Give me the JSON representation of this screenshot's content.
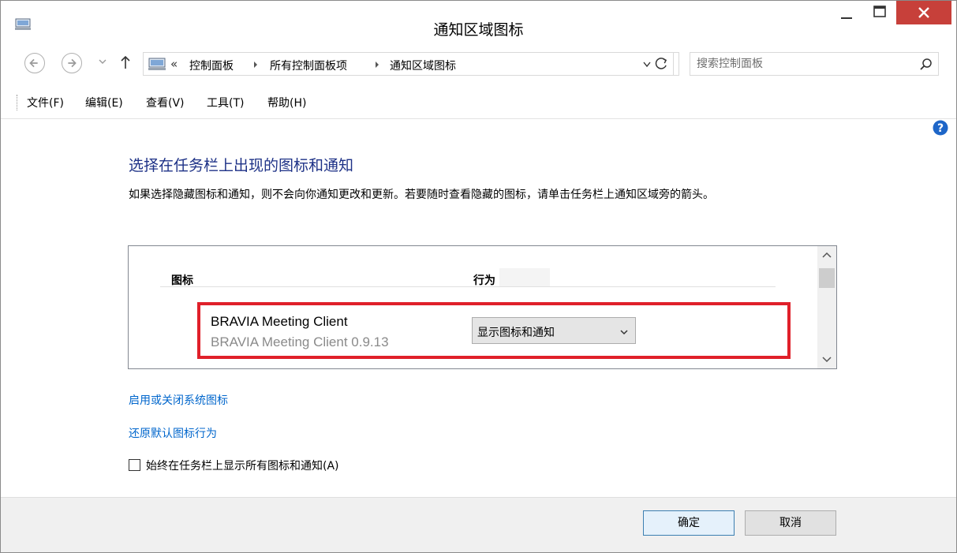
{
  "window": {
    "title": "通知区域图标"
  },
  "titlebar_buttons": {
    "minimize_icon": "minimize-icon",
    "maximize_icon": "maximize-icon",
    "close_icon": "close-icon",
    "close_color": "#c7403a"
  },
  "address": {
    "prefix": "«",
    "crumbs": [
      "控制面板",
      "所有控制面板项",
      "通知区域图标"
    ]
  },
  "search": {
    "placeholder": "搜索控制面板"
  },
  "menu": [
    "文件(F)",
    "编辑(E)",
    "查看(V)",
    "工具(T)",
    "帮助(H)"
  ],
  "main": {
    "title": "选择在任务栏上出现的图标和通知",
    "description": "如果选择隐藏图标和通知，则不会向你通知更改和更新。若要随时查看隐藏的图标，请单击任务栏上通知区域旁的箭头。",
    "columns": {
      "icon": "图标",
      "behavior": "行为"
    },
    "rows": [
      {
        "name": "BRAVIA Meeting Client",
        "subtitle": "BRAVIA Meeting Client 0.9.13",
        "behavior": "显示图标和通知"
      }
    ],
    "links": {
      "system_icons": "启用或关闭系统图标",
      "restore_default": "还原默认图标行为"
    },
    "checkbox": {
      "label": "始终在任务栏上显示所有图标和通知(A)",
      "checked": false
    }
  },
  "footer": {
    "ok": "确定",
    "cancel": "取消"
  },
  "colors": {
    "title_blue": "#1e3287",
    "link_blue": "#0066cc",
    "highlight_red": "#e0202a"
  }
}
